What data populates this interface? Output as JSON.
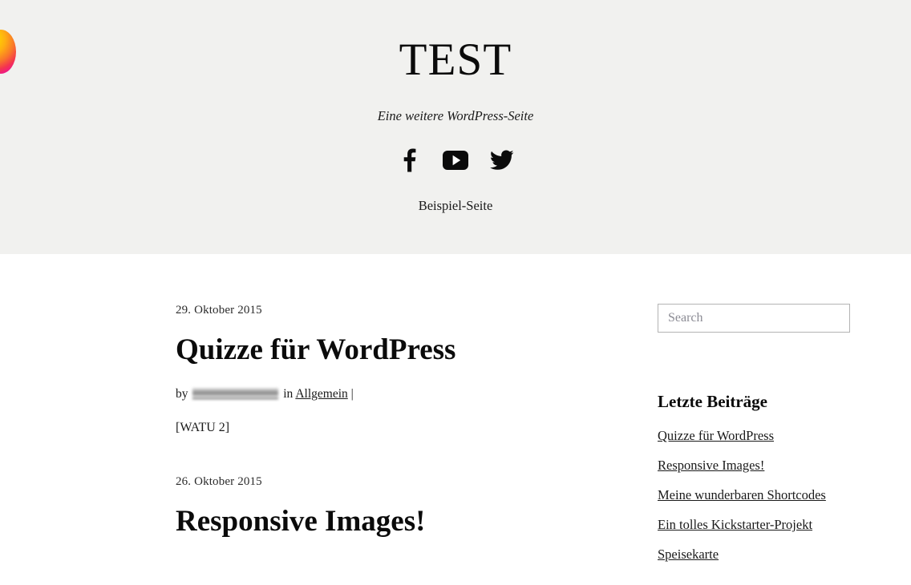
{
  "site": {
    "title": "TEST",
    "tagline": "Eine weitere WordPress-Seite"
  },
  "social": [
    {
      "name": "facebook-icon",
      "label": "Facebook"
    },
    {
      "name": "youtube-icon",
      "label": "YouTube"
    },
    {
      "name": "twitter-icon",
      "label": "Twitter"
    }
  ],
  "nav": {
    "items": [
      {
        "label": "Beispiel-Seite"
      }
    ]
  },
  "posts": [
    {
      "date": "29. Oktober 2015",
      "title": "Quizze für WordPress",
      "meta": {
        "by_label": "by",
        "author": "",
        "in_label": "in",
        "category": "Allgemein",
        "separator": "|"
      },
      "excerpt": "[WATU 2]"
    },
    {
      "date": "26. Oktober 2015",
      "title": "Responsive Images!"
    }
  ],
  "sidebar": {
    "search": {
      "placeholder": "Search",
      "value": ""
    },
    "recent": {
      "title": "Letzte Beiträge",
      "items": [
        {
          "label": "Quizze für WordPress"
        },
        {
          "label": "Responsive Images!"
        },
        {
          "label": "Meine wunderbaren Shortcodes"
        },
        {
          "label": "Ein tolles Kickstarter-Projekt"
        },
        {
          "label": "Speisekarte"
        }
      ]
    }
  },
  "colors": {
    "header_background": "#f1f1ef",
    "page_background": "#ffffff",
    "text": "#1a1a1a",
    "placeholder": "#8b8b94",
    "border": "#b3b3b3",
    "blob_gradient_start": "#ffe800",
    "blob_gradient_mid": "#f4344f",
    "blob_gradient_end": "#e300c8"
  }
}
